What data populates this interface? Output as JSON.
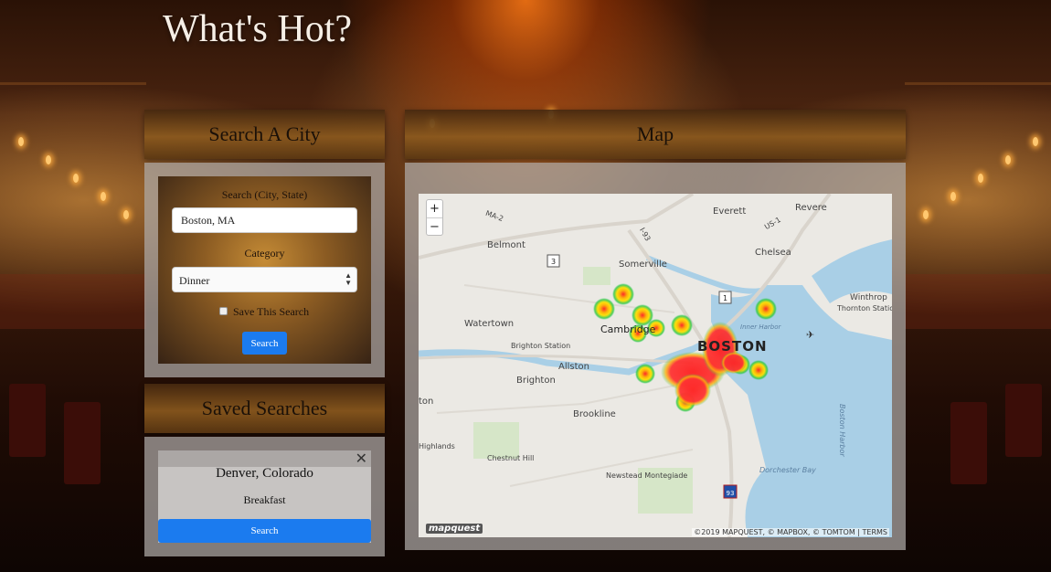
{
  "page": {
    "title": "What's Hot?"
  },
  "search_panel": {
    "heading": "Search A City",
    "location_label": "Search (City, State)",
    "location_value": "Boston, MA",
    "category_label": "Category",
    "category_selected": "Dinner",
    "save_label": "Save This Search",
    "save_checked": false,
    "search_button": "Search"
  },
  "saved_panel": {
    "heading": "Saved Searches",
    "items": [
      {
        "city": "Denver, Colorado",
        "category": "Breakfast",
        "button": "Search",
        "close": "✕"
      }
    ]
  },
  "map_panel": {
    "heading": "Map",
    "zoom_in": "+",
    "zoom_out": "−",
    "labels": {
      "everett": "Everett",
      "revere": "Revere",
      "belmont": "Belmont",
      "somerville": "Somerville",
      "chelsea": "Chelsea",
      "winthrop": "Winthrop",
      "thornton": "Thornton Statio",
      "watertown": "Watertown",
      "cambridge": "Cambridge",
      "boston": "BOSTON",
      "brighton_station": "Brighton Station",
      "allston": "Allston",
      "brighton": "Brighton",
      "ton": "ton",
      "brookline": "Brookline",
      "highlands": "Highlands",
      "chestnut_hill": "Chestnut Hill",
      "newstead": "Newstead Montegiade",
      "dorchester_bay": "Dorchester Bay",
      "boston_harbor": "Boston Harbor",
      "inner_harbor": "Inner Harbor",
      "ma2": "MA-2",
      "us1": "US-1",
      "i93": "I-93",
      "route3": "3",
      "route1": "1",
      "route93": "93"
    },
    "logo": "mapquest",
    "attribution": "©2019 MAPQUEST, © MAPBOX, © TOMTOM | TERMS",
    "heat_color_hot": "#ff2020",
    "heat_color_warm": "#ffe000",
    "heat_color_cool": "#2ec848"
  }
}
